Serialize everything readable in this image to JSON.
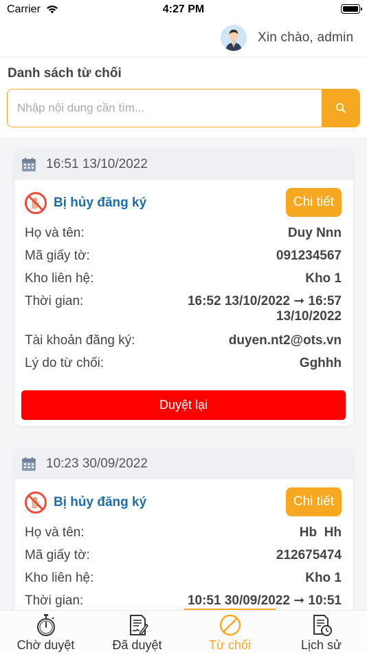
{
  "status_bar": {
    "carrier": "Carrier",
    "time": "4:27 PM"
  },
  "header": {
    "greeting": "Xin chào, admin"
  },
  "title": "Danh sách từ chối",
  "search": {
    "placeholder": "Nhập nội dung cần tìm...",
    "value": ""
  },
  "labels": {
    "name": "Họ và tên:",
    "id": "Mã giấy tờ:",
    "warehouse": "Kho liên hệ:",
    "time": "Thời gian:",
    "account": "Tài khoản đăng ký:",
    "reason": "Lý do từ chối:"
  },
  "cards": [
    {
      "timestamp": "16:51 13/10/2022",
      "status": "Bị hủy đăng ký",
      "detail_label": "Chi tiết",
      "name": "Duy Nnn",
      "id": "091234567",
      "warehouse": "Kho 1",
      "time_line1": "16:52 13/10/2022 ➞ 16:57",
      "time_line2": "13/10/2022",
      "account": "duyen.nt2@ots.vn",
      "reason": "Gghhh",
      "approve_label": "Duyệt lại"
    },
    {
      "timestamp": "10:23 30/09/2022",
      "status": "Bị hủy đăng ký",
      "detail_label": "Chi tiết",
      "name": "Hb  Hh",
      "id": "212675474",
      "warehouse": "Kho 1",
      "time_line1": "10:51 30/09/2022 ➞ 10:51"
    }
  ],
  "tabs": [
    {
      "label": "Chờ duyệt",
      "icon": "stopwatch-icon"
    },
    {
      "label": "Đã duyệt",
      "icon": "signed-document-icon"
    },
    {
      "label": "Từ chối",
      "icon": "prohibited-icon",
      "active": true
    },
    {
      "label": "Lịch sử",
      "icon": "history-document-icon"
    }
  ],
  "colors": {
    "accent": "#f7a823",
    "status_text": "#1c6ea4",
    "danger": "#ff0000"
  }
}
